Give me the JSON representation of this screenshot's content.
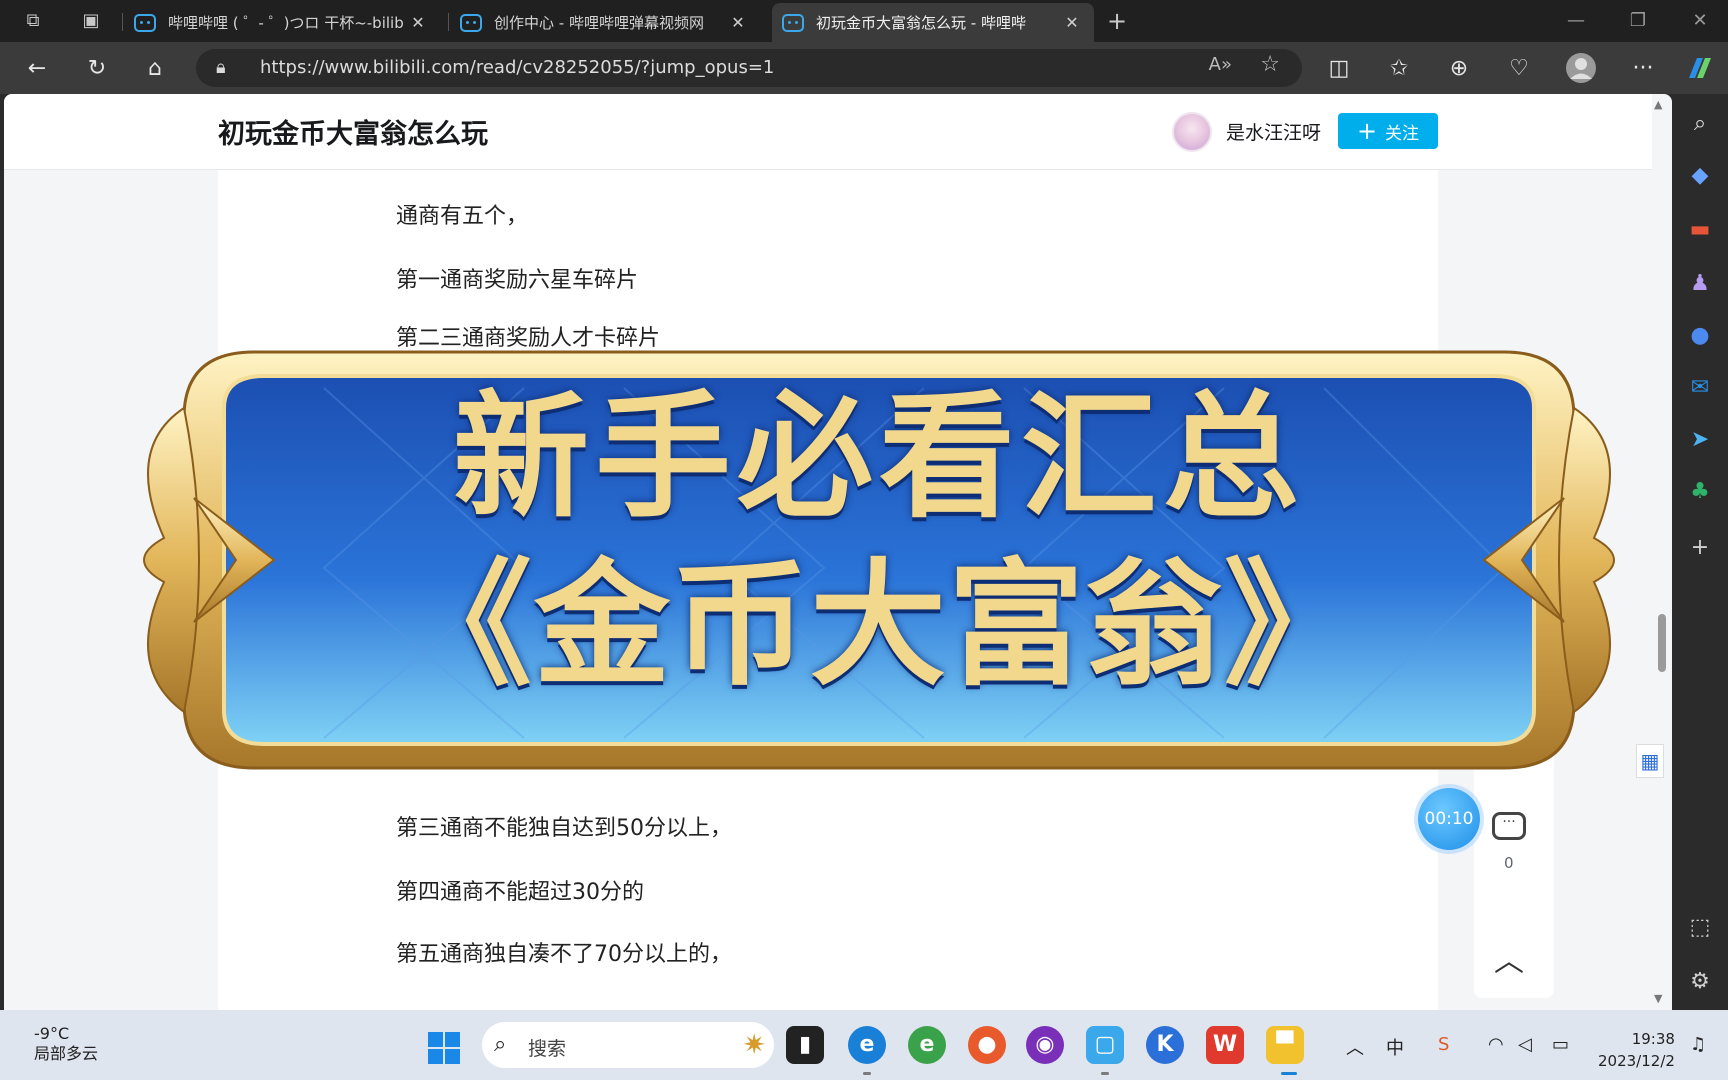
{
  "browser": {
    "tabs": [
      {
        "title": "哔哩哔哩 ( ゜- ゜)つロ 干杯~-bilib",
        "active": false
      },
      {
        "title": "创作中心 - 哔哩哔哩弹幕视频网",
        "active": false
      },
      {
        "title": "初玩金币大富翁怎么玩 - 哔哩哔",
        "active": true
      }
    ],
    "new_tab_symbol": "+",
    "url": "https://www.bilibili.com/read/cv28252055/?jump_opus=1"
  },
  "article": {
    "title": "初玩金币大富翁怎么玩",
    "author": "是水汪汪呀",
    "follow_label": "关注",
    "paragraphs_top": [
      "通商有五个，",
      "第一通商奖励六星车碎片",
      "第二三通商奖励人才卡碎片"
    ],
    "paragraphs_bottom": [
      "第三通商不能独自达到50分以上，",
      "第四通商不能超过30分的",
      "第五通商独自凑不了70分以上的，"
    ],
    "timer": "00:10",
    "comment_count": "0",
    "side_count_top": "0"
  },
  "banner": {
    "line1": "新手必看汇总",
    "line2": "《金币大富翁》"
  },
  "taskbar": {
    "temperature": "-9°C",
    "weather": "局部多云",
    "search_placeholder": "搜索",
    "ime": "中",
    "time": "19:38",
    "date": "2023/12/2"
  },
  "colors": {
    "accent": "#00aeec",
    "banner_blue": "#1d5fc4",
    "banner_gold": "#e9c66a"
  }
}
